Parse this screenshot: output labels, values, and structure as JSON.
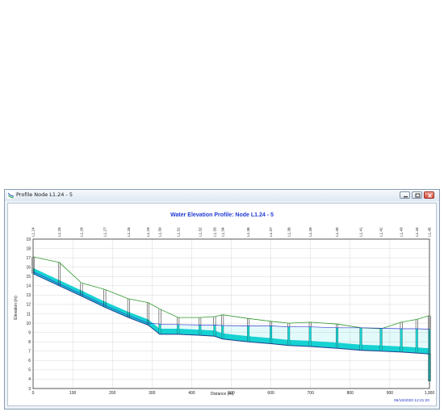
{
  "window": {
    "title": "Profile Node L1.24 - 5"
  },
  "icons": {
    "app": "profile-icon",
    "minimize": "minimize-icon",
    "maximize": "maximize-icon",
    "close": "close-icon"
  },
  "colors": {
    "ground": "#2e9a2e",
    "hgl": "#3a3ad0",
    "invert": "#1f3f8f",
    "water": "#16d2d2",
    "title": "#1f3ad6"
  },
  "chart_data": {
    "type": "line",
    "title": "Water Elevation Profile: Node L1.24 - 5",
    "xlabel": "Distance (m)",
    "ylabel": "Elevation (m)",
    "xlim": [
      0,
      1000
    ],
    "ylim": [
      3,
      19
    ],
    "xticks": [
      0,
      100,
      200,
      300,
      400,
      500,
      600,
      700,
      800,
      900,
      1000
    ],
    "xtick_labels": [
      "0",
      "100",
      "200",
      "300",
      "400",
      "500",
      "600",
      "700",
      "800",
      "900",
      "1,000"
    ],
    "yticks": [
      3,
      4,
      5,
      6,
      7,
      8,
      9,
      10,
      11,
      12,
      13,
      14,
      15,
      16,
      17,
      18,
      19
    ],
    "grid": true,
    "nodes": [
      {
        "name": "L1.24",
        "x": 0,
        "ground": 17.1,
        "invert": 15.3,
        "hgl": 15.5
      },
      {
        "name": "L1.25",
        "x": 66,
        "ground": 16.5,
        "invert": 14.0,
        "hgl": 14.2
      },
      {
        "name": "L1.26",
        "x": 122,
        "ground": 14.3,
        "invert": 12.9,
        "hgl": 13.1
      },
      {
        "name": "L1.27",
        "x": 181,
        "ground": 13.6,
        "invert": 11.7,
        "hgl": 11.9
      },
      {
        "name": "L1.28",
        "x": 241,
        "ground": 12.6,
        "invert": 10.6,
        "hgl": 10.8
      },
      {
        "name": "L1.29",
        "x": 290,
        "ground": 12.2,
        "invert": 9.8,
        "hgl": 10.0
      },
      {
        "name": "L1.30",
        "x": 320,
        "ground": 11.5,
        "invert": 8.8,
        "hgl": 9.9
      },
      {
        "name": "L1.31",
        "x": 366,
        "ground": 10.6,
        "invert": 8.8,
        "hgl": 9.85
      },
      {
        "name": "L1.32",
        "x": 421,
        "ground": 10.6,
        "invert": 8.7,
        "hgl": 9.8
      },
      {
        "name": "L1.33",
        "x": 458,
        "ground": 10.7,
        "invert": 8.6,
        "hgl": 9.8
      },
      {
        "name": "L1.34",
        "x": 478,
        "ground": 10.9,
        "invert": 8.3,
        "hgl": 9.75
      },
      {
        "name": "L1.36",
        "x": 543,
        "ground": 10.5,
        "invert": 8.0,
        "hgl": 9.7
      },
      {
        "name": "L1.37",
        "x": 600,
        "ground": 10.2,
        "invert": 7.8,
        "hgl": 9.7
      },
      {
        "name": "L1.38",
        "x": 645,
        "ground": 10.0,
        "invert": 7.6,
        "hgl": 9.6
      },
      {
        "name": "L1.39",
        "x": 699,
        "ground": 10.1,
        "invert": 7.5,
        "hgl": 9.6
      },
      {
        "name": "L1.40",
        "x": 767,
        "ground": 9.9,
        "invert": 7.3,
        "hgl": 9.5
      },
      {
        "name": "L1.41",
        "x": 827,
        "ground": 9.5,
        "invert": 7.1,
        "hgl": 9.5
      },
      {
        "name": "L1.42",
        "x": 878,
        "ground": 9.4,
        "invert": 7.0,
        "hgl": 9.45
      },
      {
        "name": "L1.43",
        "x": 929,
        "ground": 10.1,
        "invert": 6.9,
        "hgl": 9.4
      },
      {
        "name": "L1.44",
        "x": 968,
        "ground": 10.4,
        "invert": 6.8,
        "hgl": 9.4
      },
      {
        "name": "L1.45",
        "x": 1000,
        "ground": 10.8,
        "invert": 6.7,
        "hgl": 9.35
      }
    ],
    "outfall_bottom": 3.8,
    "timestamp": "06/16/2020 12:21:20"
  }
}
